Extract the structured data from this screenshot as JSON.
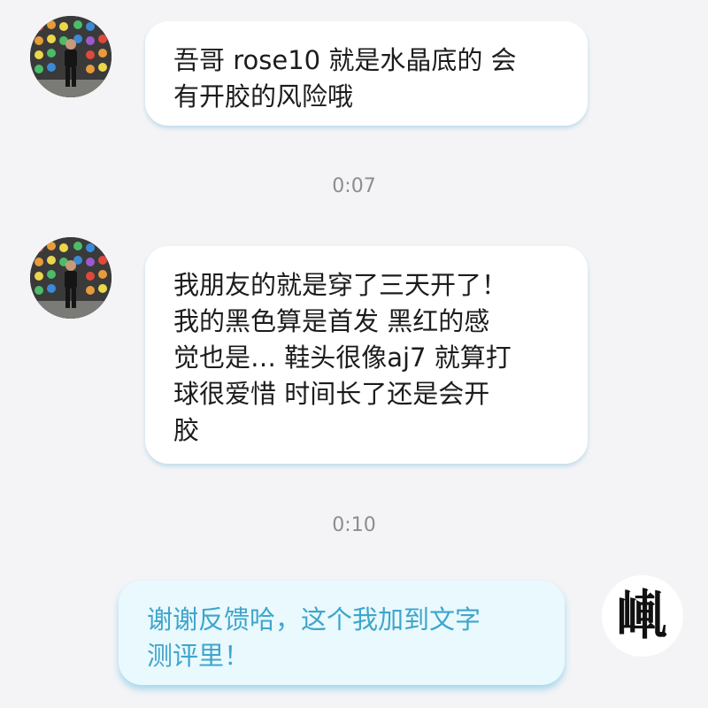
{
  "messages": [
    {
      "sender": "contact",
      "text": "吾哥 rose10 就是水晶底的 会\n有开胶的风险哦"
    },
    {
      "sender": "contact",
      "text": "我朋友的就是穿了三天开了！\n我的黑色算是首发 黑红的感\n觉也是… 鞋头很像aj7 就算打\n球很爱惜 时间长了还是会开\n胶"
    },
    {
      "sender": "self",
      "text": "谢谢反馈哈，这个我加到文字\n测评里！"
    }
  ],
  "timestamps": [
    "0:07",
    "0:10"
  ],
  "self_avatar": {
    "glyph": "𡸗"
  },
  "colors": {
    "background": "#f4f4f6",
    "incoming_bubble": "#ffffff",
    "outgoing_bubble": "#e9f9fd",
    "outgoing_text": "#3fa5cc",
    "timestamp_text": "#8d8d8d"
  }
}
